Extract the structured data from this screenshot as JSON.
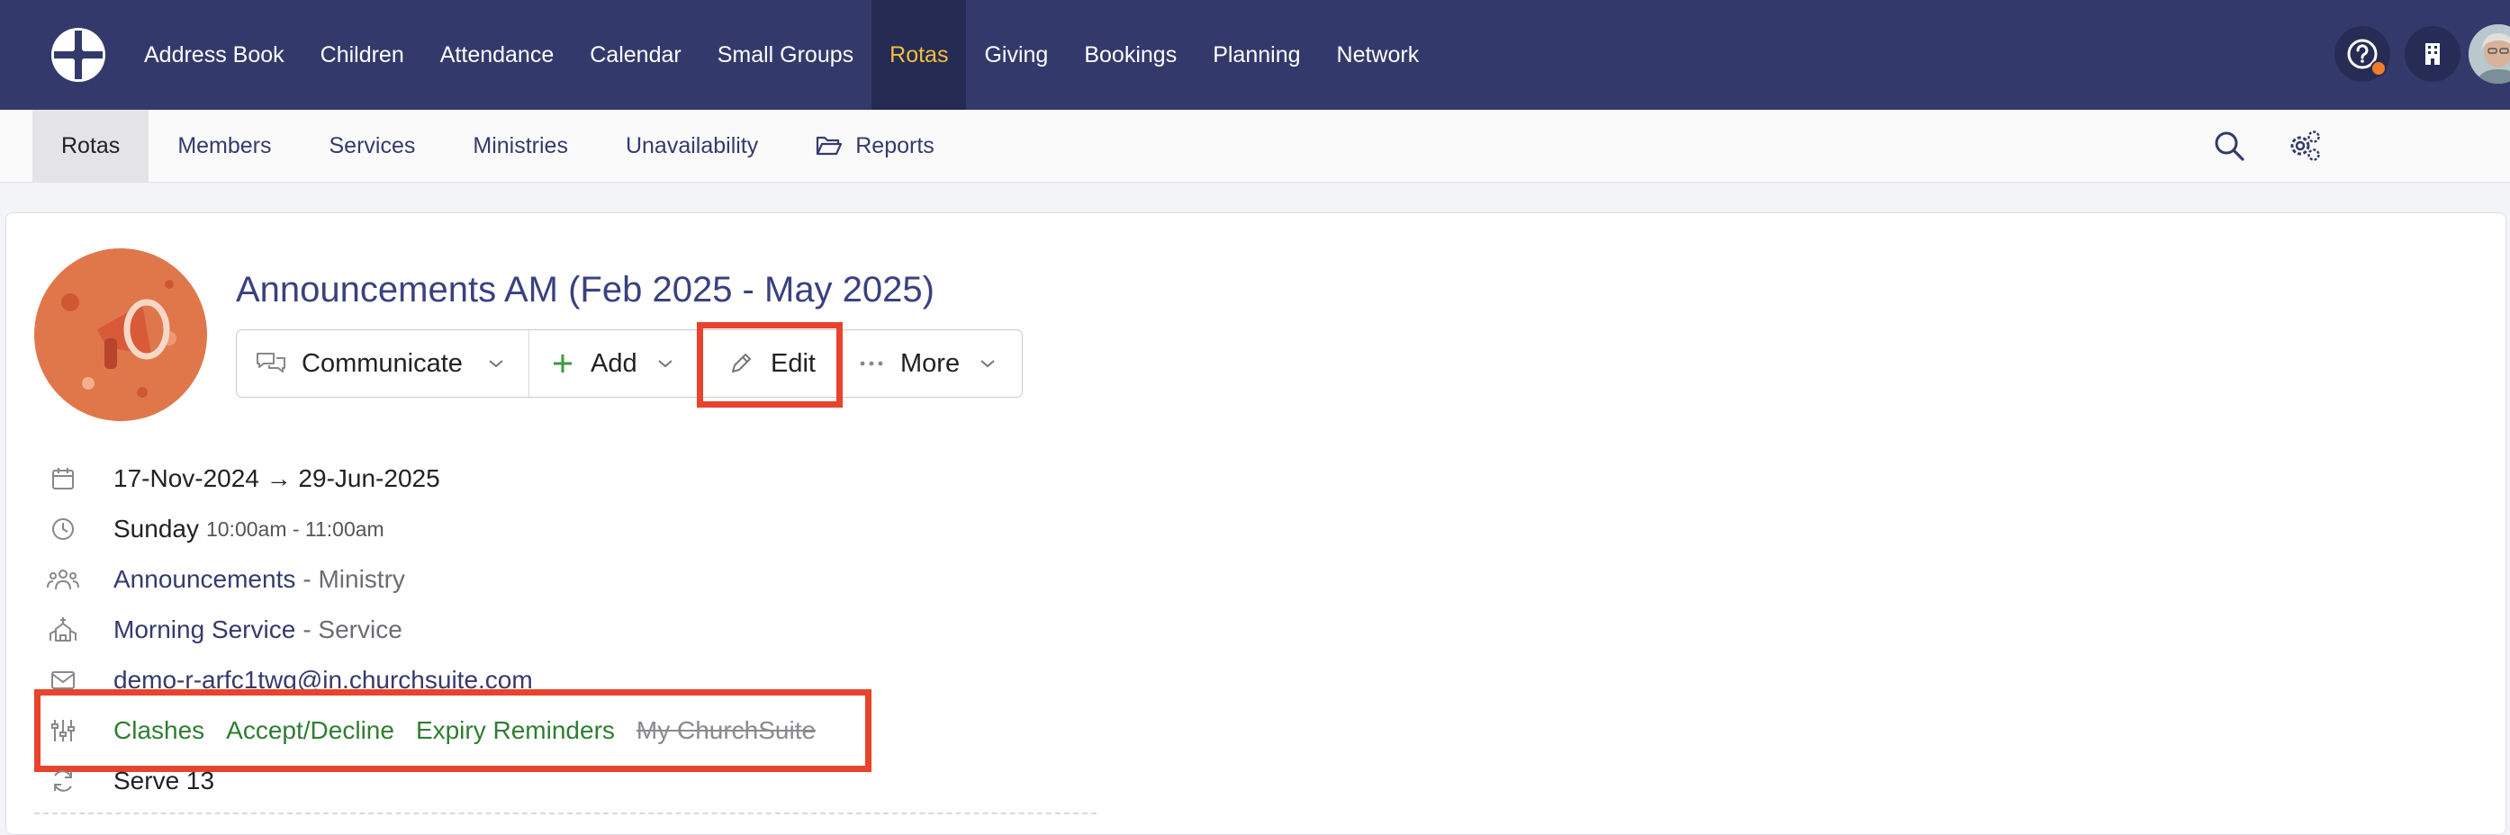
{
  "nav": {
    "items": [
      {
        "label": "Address Book"
      },
      {
        "label": "Children"
      },
      {
        "label": "Attendance"
      },
      {
        "label": "Calendar"
      },
      {
        "label": "Small Groups"
      },
      {
        "label": "Rotas",
        "active": true
      },
      {
        "label": "Giving"
      },
      {
        "label": "Bookings"
      },
      {
        "label": "Planning"
      },
      {
        "label": "Network"
      }
    ]
  },
  "subnav": {
    "items": [
      {
        "label": "Rotas",
        "active": true
      },
      {
        "label": "Members"
      },
      {
        "label": "Services"
      },
      {
        "label": "Ministries"
      },
      {
        "label": "Unavailability"
      },
      {
        "label": "Reports",
        "icon": "folder-open-icon"
      }
    ]
  },
  "rota": {
    "title": "Announcements AM (Feb 2025 - May 2025)",
    "buttons": {
      "communicate": "Communicate",
      "add": "Add",
      "edit": "Edit",
      "more": "More"
    },
    "dates": "17-Nov-2024 → 29-Jun-2025",
    "day": "Sunday",
    "time": "10:00am - 11:00am",
    "ministry_link": "Announcements",
    "ministry_suffix": "- Ministry",
    "service_link": "Morning Service",
    "service_suffix": "- Service",
    "email": "demo-r-arfc1twg@in.churchsuite.com",
    "settings": {
      "clashes": "Clashes",
      "accept_decline": "Accept/Decline",
      "expiry_reminders": "Expiry Reminders",
      "my_churchsuite": "My ChurchSuite"
    },
    "serve": "Serve 13"
  },
  "colors": {
    "topbar": "#333a6b",
    "active_nav": "#f2bf3f",
    "link": "#343b6c",
    "green": "#2f7d32",
    "highlight": "#e8432c"
  }
}
